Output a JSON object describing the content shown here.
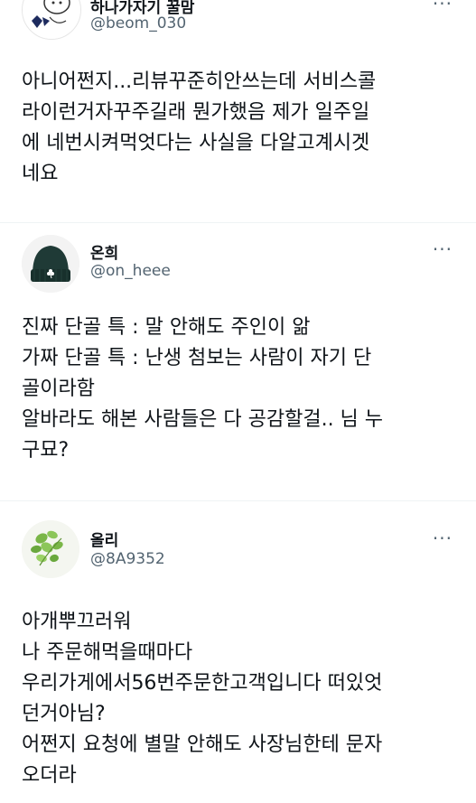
{
  "tweets": [
    {
      "name": "하나가자기 꿀맘",
      "handle": "@beom_030",
      "more": "···",
      "lines": [
        "아니어쩐지...리뷰꾸준히안쓰는데 서비스콜",
        "라이런거자꾸주길래 뭔가했음 제가 일주일",
        "에 네번시켜먹엇다는 사실을 다알고계시겟",
        "네요"
      ]
    },
    {
      "name": "온희",
      "handle": "@on_heee",
      "more": "···",
      "lines": [
        "진짜 단골 특 : 말 안해도 주인이 앎",
        "가짜 단골 특 : 난생 첨보는 사람이 자기 단",
        "골이라함",
        "알바라도 해본 사람들은 다 공감할걸.. 님 누",
        "구묘?"
      ]
    },
    {
      "name": "올리",
      "handle": "@8A9352",
      "more": "···",
      "lines": [
        "아개뿌끄러워",
        "나 주문해먹을때마다",
        "우리가게에서56번주문한고객입니다 떠있엇",
        "던거아님?",
        "어쩐지 요청에 별말 안해도 사장님한테 문자",
        "오더라"
      ]
    }
  ]
}
